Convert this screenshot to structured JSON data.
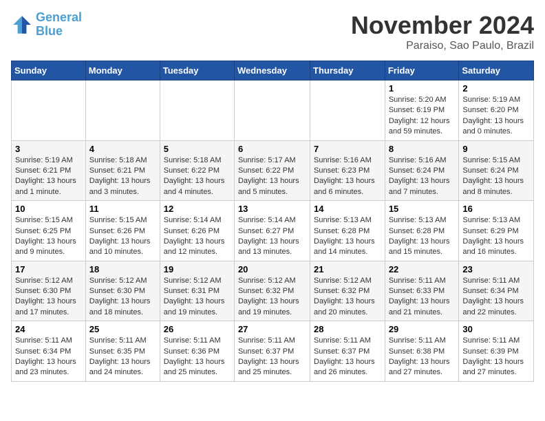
{
  "logo": {
    "line1": "General",
    "line2": "Blue"
  },
  "title": "November 2024",
  "location": "Paraiso, Sao Paulo, Brazil",
  "days_of_week": [
    "Sunday",
    "Monday",
    "Tuesday",
    "Wednesday",
    "Thursday",
    "Friday",
    "Saturday"
  ],
  "weeks": [
    [
      {
        "day": "",
        "info": ""
      },
      {
        "day": "",
        "info": ""
      },
      {
        "day": "",
        "info": ""
      },
      {
        "day": "",
        "info": ""
      },
      {
        "day": "",
        "info": ""
      },
      {
        "day": "1",
        "info": "Sunrise: 5:20 AM\nSunset: 6:19 PM\nDaylight: 12 hours and 59 minutes."
      },
      {
        "day": "2",
        "info": "Sunrise: 5:19 AM\nSunset: 6:20 PM\nDaylight: 13 hours and 0 minutes."
      }
    ],
    [
      {
        "day": "3",
        "info": "Sunrise: 5:19 AM\nSunset: 6:21 PM\nDaylight: 13 hours and 1 minute."
      },
      {
        "day": "4",
        "info": "Sunrise: 5:18 AM\nSunset: 6:21 PM\nDaylight: 13 hours and 3 minutes."
      },
      {
        "day": "5",
        "info": "Sunrise: 5:18 AM\nSunset: 6:22 PM\nDaylight: 13 hours and 4 minutes."
      },
      {
        "day": "6",
        "info": "Sunrise: 5:17 AM\nSunset: 6:22 PM\nDaylight: 13 hours and 5 minutes."
      },
      {
        "day": "7",
        "info": "Sunrise: 5:16 AM\nSunset: 6:23 PM\nDaylight: 13 hours and 6 minutes."
      },
      {
        "day": "8",
        "info": "Sunrise: 5:16 AM\nSunset: 6:24 PM\nDaylight: 13 hours and 7 minutes."
      },
      {
        "day": "9",
        "info": "Sunrise: 5:15 AM\nSunset: 6:24 PM\nDaylight: 13 hours and 8 minutes."
      }
    ],
    [
      {
        "day": "10",
        "info": "Sunrise: 5:15 AM\nSunset: 6:25 PM\nDaylight: 13 hours and 9 minutes."
      },
      {
        "day": "11",
        "info": "Sunrise: 5:15 AM\nSunset: 6:26 PM\nDaylight: 13 hours and 10 minutes."
      },
      {
        "day": "12",
        "info": "Sunrise: 5:14 AM\nSunset: 6:26 PM\nDaylight: 13 hours and 12 minutes."
      },
      {
        "day": "13",
        "info": "Sunrise: 5:14 AM\nSunset: 6:27 PM\nDaylight: 13 hours and 13 minutes."
      },
      {
        "day": "14",
        "info": "Sunrise: 5:13 AM\nSunset: 6:28 PM\nDaylight: 13 hours and 14 minutes."
      },
      {
        "day": "15",
        "info": "Sunrise: 5:13 AM\nSunset: 6:28 PM\nDaylight: 13 hours and 15 minutes."
      },
      {
        "day": "16",
        "info": "Sunrise: 5:13 AM\nSunset: 6:29 PM\nDaylight: 13 hours and 16 minutes."
      }
    ],
    [
      {
        "day": "17",
        "info": "Sunrise: 5:12 AM\nSunset: 6:30 PM\nDaylight: 13 hours and 17 minutes."
      },
      {
        "day": "18",
        "info": "Sunrise: 5:12 AM\nSunset: 6:30 PM\nDaylight: 13 hours and 18 minutes."
      },
      {
        "day": "19",
        "info": "Sunrise: 5:12 AM\nSunset: 6:31 PM\nDaylight: 13 hours and 19 minutes."
      },
      {
        "day": "20",
        "info": "Sunrise: 5:12 AM\nSunset: 6:32 PM\nDaylight: 13 hours and 19 minutes."
      },
      {
        "day": "21",
        "info": "Sunrise: 5:12 AM\nSunset: 6:32 PM\nDaylight: 13 hours and 20 minutes."
      },
      {
        "day": "22",
        "info": "Sunrise: 5:11 AM\nSunset: 6:33 PM\nDaylight: 13 hours and 21 minutes."
      },
      {
        "day": "23",
        "info": "Sunrise: 5:11 AM\nSunset: 6:34 PM\nDaylight: 13 hours and 22 minutes."
      }
    ],
    [
      {
        "day": "24",
        "info": "Sunrise: 5:11 AM\nSunset: 6:34 PM\nDaylight: 13 hours and 23 minutes."
      },
      {
        "day": "25",
        "info": "Sunrise: 5:11 AM\nSunset: 6:35 PM\nDaylight: 13 hours and 24 minutes."
      },
      {
        "day": "26",
        "info": "Sunrise: 5:11 AM\nSunset: 6:36 PM\nDaylight: 13 hours and 25 minutes."
      },
      {
        "day": "27",
        "info": "Sunrise: 5:11 AM\nSunset: 6:37 PM\nDaylight: 13 hours and 25 minutes."
      },
      {
        "day": "28",
        "info": "Sunrise: 5:11 AM\nSunset: 6:37 PM\nDaylight: 13 hours and 26 minutes."
      },
      {
        "day": "29",
        "info": "Sunrise: 5:11 AM\nSunset: 6:38 PM\nDaylight: 13 hours and 27 minutes."
      },
      {
        "day": "30",
        "info": "Sunrise: 5:11 AM\nSunset: 6:39 PM\nDaylight: 13 hours and 27 minutes."
      }
    ]
  ]
}
